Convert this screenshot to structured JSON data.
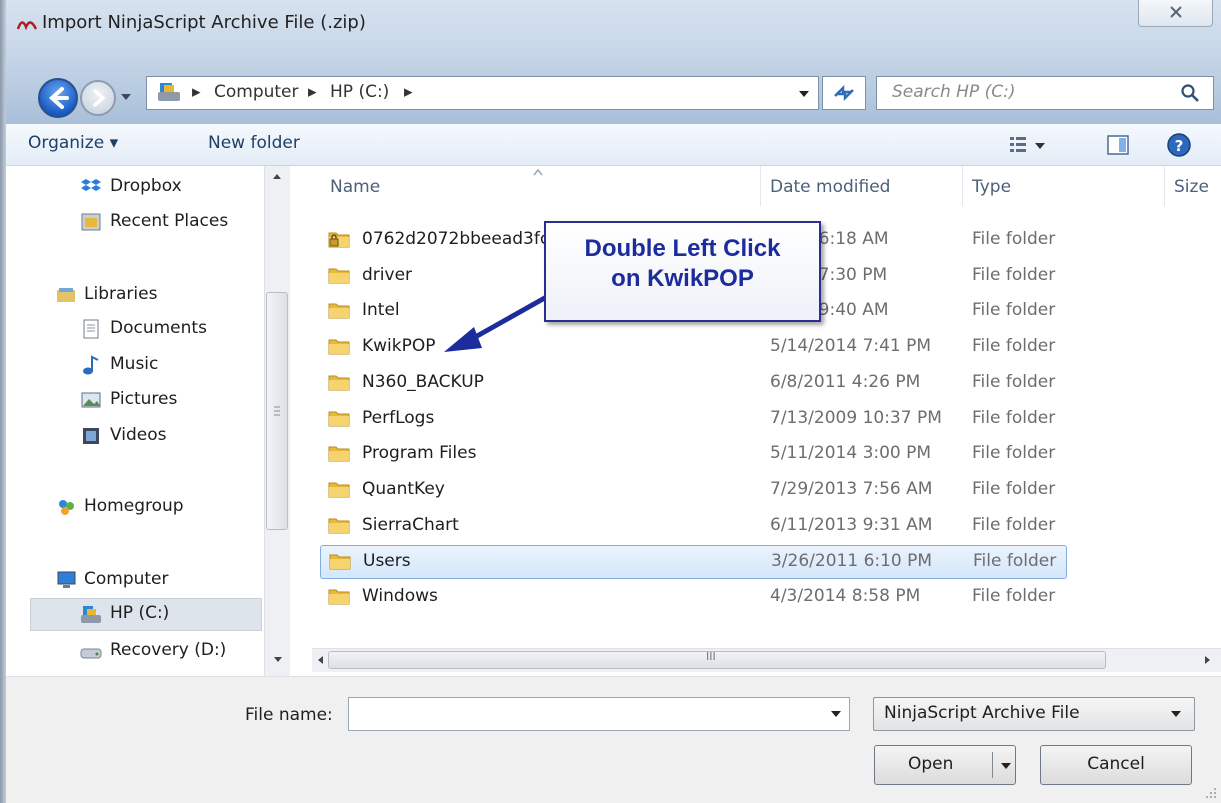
{
  "window": {
    "title": "Import NinjaScript Archive File (.zip)"
  },
  "address": {
    "crumbs": [
      "Computer",
      "HP (C:)"
    ]
  },
  "search": {
    "placeholder": "Search HP (C:)"
  },
  "toolbar": {
    "organize": "Organize ▾",
    "new_folder": "New folder"
  },
  "nav": {
    "items": [
      {
        "label": "Dropbox",
        "icon": "dropbox-icon"
      },
      {
        "label": "Recent Places",
        "icon": "recent-places-icon"
      },
      {
        "label": "Libraries",
        "icon": "libraries-icon"
      },
      {
        "label": "Documents",
        "icon": "documents-icon"
      },
      {
        "label": "Music",
        "icon": "music-icon"
      },
      {
        "label": "Pictures",
        "icon": "pictures-icon"
      },
      {
        "label": "Videos",
        "icon": "videos-icon"
      },
      {
        "label": "Homegroup",
        "icon": "homegroup-icon"
      },
      {
        "label": "Computer",
        "icon": "computer-icon"
      },
      {
        "label": "HP (C:)",
        "icon": "drive-icon"
      },
      {
        "label": "Recovery (D:)",
        "icon": "recovery-drive-icon"
      }
    ],
    "selected": "HP (C:)"
  },
  "columns": {
    "name": "Name",
    "date": "Date modified",
    "type": "Type",
    "size": "Size"
  },
  "files": [
    {
      "name": "0762d2072bbeead3fc",
      "date": "2011 6:18 AM",
      "type": "File folder"
    },
    {
      "name": "driver",
      "date": "2011 7:30 PM",
      "type": "File folder"
    },
    {
      "name": "Intel",
      "date": "2007 9:40 AM",
      "type": "File folder"
    },
    {
      "name": "KwikPOP",
      "date": "5/14/2014 7:41 PM",
      "type": "File folder"
    },
    {
      "name": "N360_BACKUP",
      "date": "6/8/2011 4:26 PM",
      "type": "File folder"
    },
    {
      "name": "PerfLogs",
      "date": "7/13/2009 10:37 PM",
      "type": "File folder"
    },
    {
      "name": "Program Files",
      "date": "5/11/2014 3:00 PM",
      "type": "File folder"
    },
    {
      "name": "QuantKey",
      "date": "7/29/2013 7:56 AM",
      "type": "File folder"
    },
    {
      "name": "SierraChart",
      "date": "6/11/2013 9:31 AM",
      "type": "File folder"
    },
    {
      "name": "Users",
      "date": "3/26/2011 6:10 PM",
      "type": "File folder"
    },
    {
      "name": "Windows",
      "date": "4/3/2014 8:58 PM",
      "type": "File folder"
    }
  ],
  "selected_file": "Users",
  "callout": {
    "line1": "Double Left Click",
    "line2": "on KwikPOP"
  },
  "hscroll": {
    "grip": "III"
  },
  "filename": {
    "label": "File name:",
    "value": ""
  },
  "filter": {
    "selected": "NinjaScript Archive File"
  },
  "buttons": {
    "open": "Open",
    "cancel": "Cancel"
  },
  "colors": {
    "accent": "#1c2c9c",
    "selection": "#d5e7fb",
    "folder": "#e8b83a"
  }
}
